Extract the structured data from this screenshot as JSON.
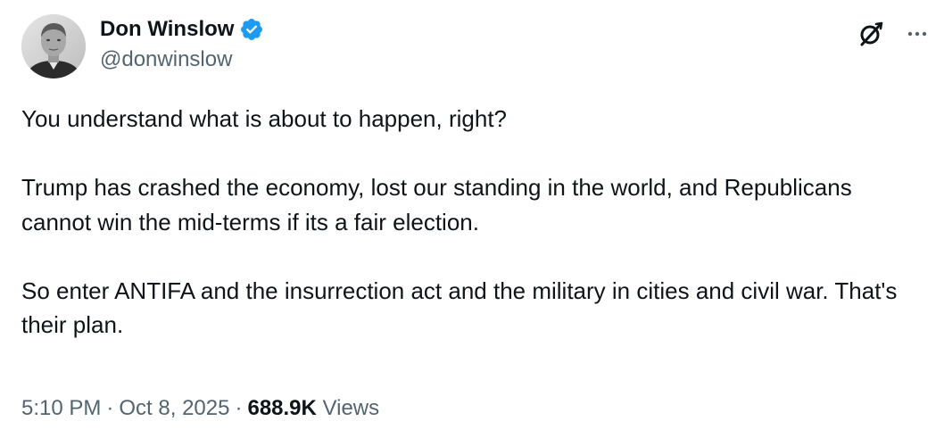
{
  "author": {
    "display_name": "Don Winslow",
    "handle": "@donwinslow",
    "verified": true
  },
  "colors": {
    "verified_badge": "#1d9bf0",
    "secondary_text": "#536471",
    "primary_text": "#0f1419"
  },
  "icons": {
    "avatar": "avatar",
    "verified": "verified-badge-icon",
    "grok": "grok-icon",
    "more": "more-options-icon"
  },
  "tweet": {
    "paragraphs": [
      "You understand what is about to happen, right?",
      "Trump has crashed the economy, lost our standing in the world, and Republicans cannot win the mid-terms if its a fair election.",
      "So enter ANTIFA and the insurrection act and the military in cities and civil war. That's their plan."
    ]
  },
  "meta": {
    "time": "5:10 PM",
    "separator": "·",
    "date": "Oct 8, 2025",
    "views_count": "688.9K",
    "views_label": "Views"
  }
}
